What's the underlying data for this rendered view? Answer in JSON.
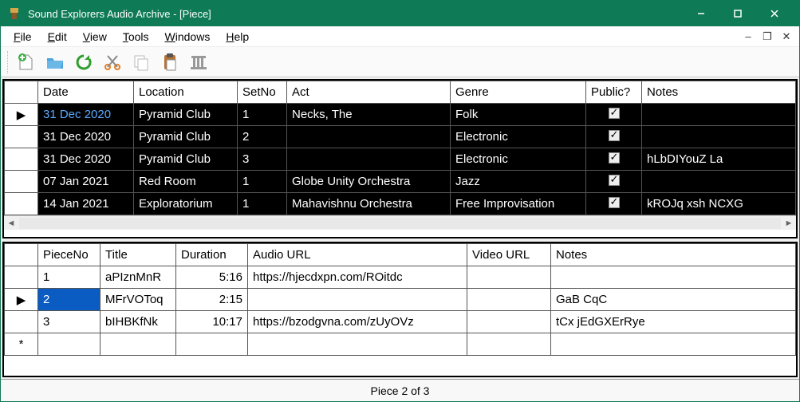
{
  "window": {
    "title": "Sound Explorers Audio Archive - [Piece]"
  },
  "menu": {
    "file": "File",
    "edit": "Edit",
    "view": "View",
    "tools": "Tools",
    "windows": "Windows",
    "help": "Help"
  },
  "top_grid": {
    "headers": {
      "date": "Date",
      "location": "Location",
      "setno": "SetNo",
      "act": "Act",
      "genre": "Genre",
      "public": "Public?",
      "notes": "Notes"
    },
    "rows": [
      {
        "marker": "▶",
        "date": "31 Dec 2020",
        "date_link": true,
        "location": "Pyramid Club",
        "setno": "1",
        "act": "Necks, The",
        "genre": "Folk",
        "public": true,
        "notes": ""
      },
      {
        "marker": "",
        "date": "31 Dec 2020",
        "date_link": false,
        "location": "Pyramid Club",
        "setno": "2",
        "act": "",
        "genre": "Electronic",
        "public": true,
        "notes": ""
      },
      {
        "marker": "",
        "date": "31 Dec 2020",
        "date_link": false,
        "location": "Pyramid Club",
        "setno": "3",
        "act": "",
        "genre": "Electronic",
        "public": true,
        "notes": "hLbDIYouZ La"
      },
      {
        "marker": "",
        "date": "07 Jan 2021",
        "date_link": false,
        "location": "Red Room",
        "setno": "1",
        "act": "Globe Unity Orchestra",
        "genre": "Jazz",
        "public": true,
        "notes": ""
      },
      {
        "marker": "",
        "date": "14 Jan 2021",
        "date_link": false,
        "location": "Exploratorium",
        "setno": "1",
        "act": "Mahavishnu Orchestra",
        "genre": "Free Improvisation",
        "public": true,
        "notes": "kROJq xsh NCXG"
      }
    ]
  },
  "bottom_grid": {
    "headers": {
      "pieceno": "PieceNo",
      "title": "Title",
      "duration": "Duration",
      "audio_url": "Audio URL",
      "video_url": "Video URL",
      "notes": "Notes"
    },
    "rows": [
      {
        "marker": "",
        "selected": false,
        "pieceno": "1",
        "title": "aPIznMnR",
        "duration": "5:16",
        "audio_url": "https://hjecdxpn.com/ROitdc",
        "video_url": "",
        "notes": ""
      },
      {
        "marker": "▶",
        "selected": true,
        "pieceno": "2",
        "title": "MFrVOToq",
        "duration": "2:15",
        "audio_url": "",
        "video_url": "",
        "notes": "GaB CqC"
      },
      {
        "marker": "",
        "selected": false,
        "pieceno": "3",
        "title": "bIHBKfNk",
        "duration": "10:17",
        "audio_url": "https://bzodgvna.com/zUyOVz",
        "video_url": "",
        "notes": "tCx jEdGXErRye"
      }
    ],
    "new_row_marker": "*"
  },
  "status": {
    "text": "Piece 2 of 3"
  }
}
